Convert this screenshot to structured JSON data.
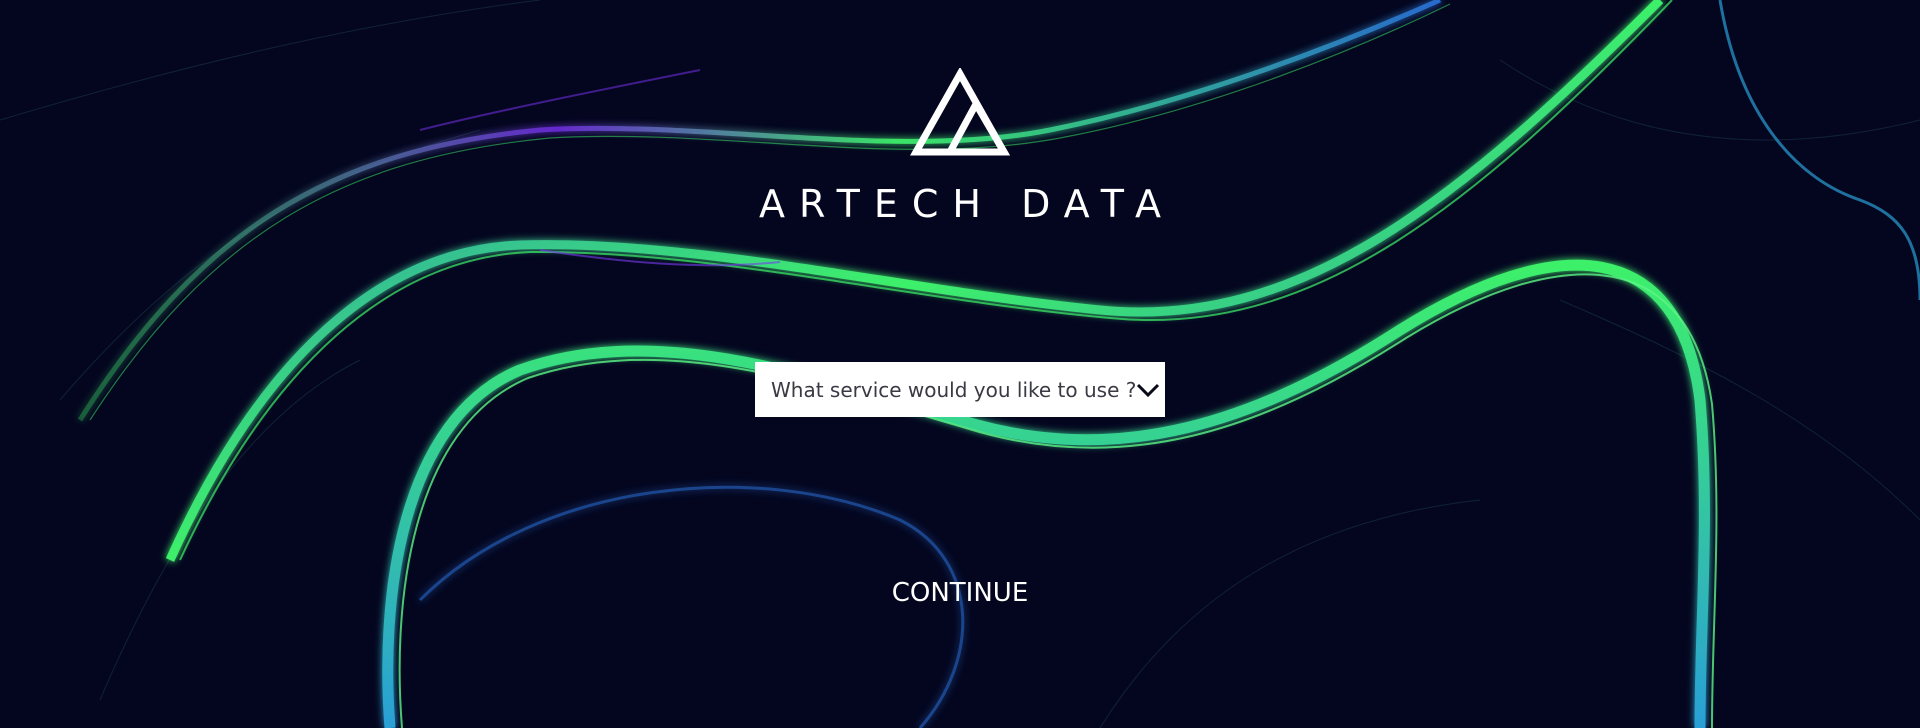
{
  "brand": {
    "name": "ARTECH DATA",
    "logo_icon": "triangle-logo-icon"
  },
  "service_select": {
    "placeholder": "What service would you like to use ?",
    "icon": "chevron-down-icon"
  },
  "actions": {
    "continue_label": "CONTINUE"
  },
  "colors": {
    "background": "#04061f",
    "accent_green": "#3df06a",
    "accent_blue": "#2a6fd6",
    "accent_purple": "#6a2bd6",
    "text": "#ffffff"
  }
}
